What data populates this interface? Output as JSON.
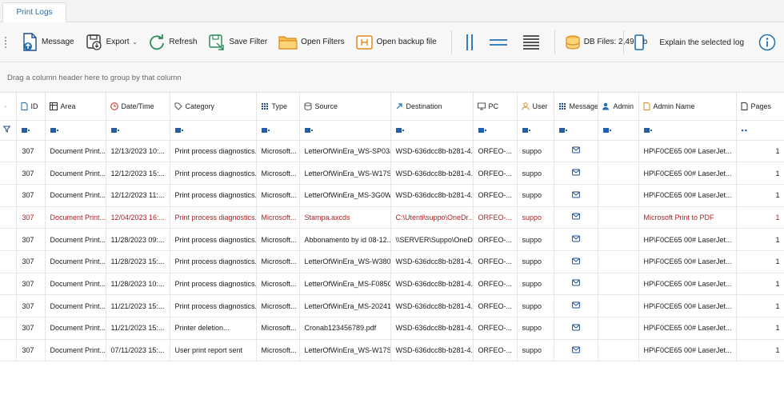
{
  "tab": {
    "label": "Print Logs"
  },
  "toolbar": {
    "message": "Message",
    "export": "Export",
    "refresh": "Refresh",
    "save_filter": "Save Filter",
    "open_filters": "Open Filters",
    "open_backup": "Open backup file",
    "db_files": "DB Files: 2,49 Mb",
    "explain": "Explain the selected log"
  },
  "group_hint": "Drag a column header here to group by that column",
  "columns": {
    "id": "ID",
    "area": "Area",
    "datetime": "Date/Time",
    "category": "Category",
    "type": "Type",
    "source": "Source",
    "destination": "Destination",
    "pc": "PC",
    "user": "User",
    "message": "Message",
    "admin": "Admin",
    "admin_name": "Admin Name",
    "pages": "Pages"
  },
  "rows": [
    {
      "id": "307",
      "area": "Document Print...",
      "datetime": "12/13/2023 10:...",
      "category": "Print process diagnostics...",
      "type": "Microsoft...",
      "source": "LetterOfWinEra_WS-SP03a...",
      "destination": "WSD-636dcc8b-b281-4...",
      "pc": "ORFEO-...",
      "user": "suppo",
      "admin": "",
      "admin_name": "HP\\F0CE65 00# LaserJet...",
      "pages": "1"
    },
    {
      "id": "307",
      "area": "Document Print...",
      "datetime": "12/12/2023 15:...",
      "category": "Print process diagnostics...",
      "type": "Microsoft...",
      "source": "LetterOfWinEra_WS-W17S...",
      "destination": "WSD-636dcc8b-b281-4...",
      "pc": "ORFEO-...",
      "user": "suppo",
      "admin": "",
      "admin_name": "HP\\F0CE65 00# LaserJet...",
      "pages": "1"
    },
    {
      "id": "307",
      "area": "Document Print...",
      "datetime": "12/12/2023 11:...",
      "category": "Print process diagnostics...",
      "type": "Microsoft...",
      "source": "LetterOfWinEra_MS-3G0W...",
      "destination": "WSD-636dcc8b-b281-4...",
      "pc": "ORFEO-...",
      "user": "suppo",
      "admin": "",
      "admin_name": "HP\\F0CE65 00# LaserJet...",
      "pages": "1"
    },
    {
      "id": "307",
      "area": "Document Print...",
      "datetime": "12/04/2023 16:...",
      "category": "Print process diagnostics...",
      "type": "Microsoft...",
      "source": "Stampa.axcds",
      "destination": "C:\\Utenti\\suppo\\OneDr...",
      "pc": "ORFEO-...",
      "user": "suppo",
      "admin": "",
      "admin_name": "Microsoft Print to PDF",
      "pages": "1"
    },
    {
      "id": "307",
      "area": "Document Print...",
      "datetime": "11/28/2023 09:...",
      "category": "Print process diagnostics...",
      "type": "Microsoft...",
      "source": "Abbonamento by id 08-12...",
      "destination": "\\\\SERVER\\Suppo\\OneDr...",
      "pc": "ORFEO-...",
      "user": "suppo",
      "admin": "",
      "admin_name": "HP\\F0CE65 00# LaserJet...",
      "pages": "1"
    },
    {
      "id": "307",
      "area": "Document Print...",
      "datetime": "11/28/2023 15:...",
      "category": "Print process diagnostics...",
      "type": "Microsoft...",
      "source": "LetterOfWinEra_WS-W380...",
      "destination": "WSD-636dcc8b-b281-4...",
      "pc": "ORFEO-...",
      "user": "suppo",
      "admin": "",
      "admin_name": "HP\\F0CE65 00# LaserJet...",
      "pages": "1"
    },
    {
      "id": "307",
      "area": "Document Print...",
      "datetime": "11/28/2023 10:...",
      "category": "Print process diagnostics...",
      "type": "Microsoft...",
      "source": "LetterOfWinEra_MS-F085C...",
      "destination": "WSD-636dcc8b-b281-4...",
      "pc": "ORFEO-...",
      "user": "suppo",
      "admin": "",
      "admin_name": "HP\\F0CE65 00# LaserJet...",
      "pages": "1"
    },
    {
      "id": "307",
      "area": "Document Print...",
      "datetime": "11/21/2023 15:...",
      "category": "Print process diagnostics...",
      "type": "Microsoft...",
      "source": "LetterOfWinEra_MS-20241...",
      "destination": "WSD-636dcc8b-b281-4...",
      "pc": "ORFEO-...",
      "user": "suppo",
      "admin": "",
      "admin_name": "HP\\F0CE65 00# LaserJet...",
      "pages": "1"
    },
    {
      "id": "307",
      "area": "Document Print...",
      "datetime": "11/21/2023 15:...",
      "category": "Printer deletion...",
      "type": "Microsoft...",
      "source": "Cronab123456789.pdf",
      "destination": "WSD-636dcc8b-b281-4...",
      "pc": "ORFEO-...",
      "user": "suppo",
      "admin": "",
      "admin_name": "HP\\F0CE65 00# LaserJet...",
      "pages": "1"
    },
    {
      "id": "307",
      "area": "Document Print...",
      "datetime": "07/11/2023 15:...",
      "category": "User print report sent",
      "type": "Microsoft...",
      "source": "LetterOfWinEra_WS-W17S...",
      "destination": "WSD-636dcc8b-b281-4...",
      "pc": "ORFEO-...",
      "user": "suppo",
      "admin": "",
      "admin_name": "HP\\F0CE65 00# LaserJet...",
      "pages": "1"
    }
  ],
  "highlighted_row_index": 3,
  "colors": {
    "accent": "#1f6fb5",
    "highlight_text": "#b01e1e",
    "icon_orange": "#e08a1e",
    "icon_green": "#2e8b57"
  },
  "icons": [
    "message-icon",
    "export-icon",
    "refresh-icon",
    "save-filter-icon",
    "folder-icon",
    "backup-icon",
    "layout-columns-icon",
    "layout-rows-icon",
    "layout-grid-icon",
    "database-icon",
    "mobile-icon",
    "info-icon"
  ]
}
